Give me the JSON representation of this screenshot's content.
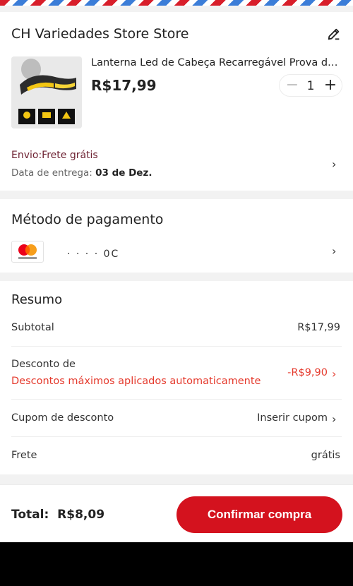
{
  "store": {
    "name": "CH Variedades Store Store",
    "edit_icon": "pencil-icon"
  },
  "product": {
    "title": "Lanterna Led de Cabeça Recarregável Prova d'Água",
    "price": "R$17,99",
    "quantity": "1",
    "minus_icon": "minus-icon",
    "plus_icon": "plus-icon"
  },
  "shipping": {
    "label": "Envio:Frete grátis",
    "date_label": "Data de entrega:",
    "date_value": "03 de Dez."
  },
  "payment": {
    "title": "Método de pagamento",
    "card_brand": "mastercard",
    "masked_number": "· · · · 0C"
  },
  "summary": {
    "title": "Resumo",
    "subtotal_label": "Subtotal",
    "subtotal_value": "R$17,99",
    "discount_label": "Desconto de",
    "discount_note": "Descontos máximos aplicados automaticamente",
    "discount_value": "-R$9,90",
    "coupon_label": "Cupom de desconto",
    "coupon_value": "Inserir cupom",
    "freight_label": "Frete",
    "freight_value": "grátis"
  },
  "footer": {
    "total_label": "Total:",
    "total_value": "R$8,09",
    "confirm_label": "Confirmar compra"
  },
  "colors": {
    "accent": "#d4121e",
    "discount": "#e53a2d",
    "shipping": "#6e2232"
  }
}
